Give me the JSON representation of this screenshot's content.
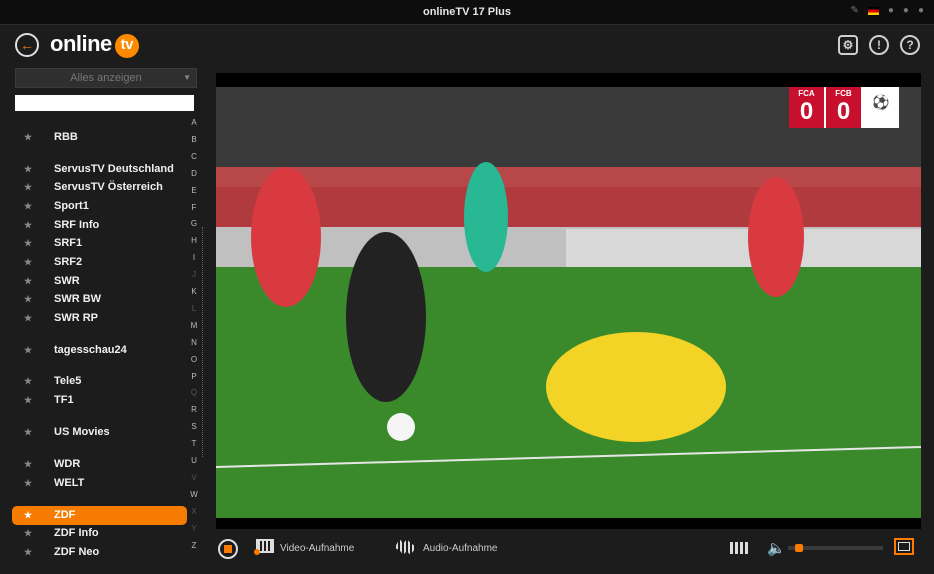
{
  "window": {
    "title": "onlineTV 17 Plus"
  },
  "header": {
    "logo_text": "online",
    "logo_badge": "tv"
  },
  "sidebar": {
    "filter_value": "Alles anzeigen",
    "search_value": "",
    "channels": [
      {
        "name": "RBB",
        "active": false
      },
      {
        "name": "ServusTV Deutschland",
        "active": false
      },
      {
        "name": "ServusTV Österreich",
        "active": false
      },
      {
        "name": "Sport1",
        "active": false
      },
      {
        "name": "SRF Info",
        "active": false
      },
      {
        "name": "SRF1",
        "active": false
      },
      {
        "name": "SRF2",
        "active": false
      },
      {
        "name": "SWR",
        "active": false
      },
      {
        "name": "SWR BW",
        "active": false
      },
      {
        "name": "SWR RP",
        "active": false
      },
      {
        "name": "tagesschau24",
        "active": false
      },
      {
        "name": "Tele5",
        "active": false
      },
      {
        "name": "TF1",
        "active": false
      },
      {
        "name": "US Movies",
        "active": false
      },
      {
        "name": "WDR",
        "active": false
      },
      {
        "name": "WELT",
        "active": false
      },
      {
        "name": "ZDF",
        "active": true
      },
      {
        "name": "ZDF Info",
        "active": false
      },
      {
        "name": "ZDF Neo",
        "active": false
      }
    ],
    "alphabet": [
      "A",
      "B",
      "C",
      "D",
      "E",
      "F",
      "G",
      "H",
      "I",
      "J",
      "K",
      "L",
      "M",
      "N",
      "O",
      "P",
      "Q",
      "R",
      "S",
      "T",
      "U",
      "V",
      "W",
      "X",
      "Y",
      "Z"
    ]
  },
  "video": {
    "score": {
      "home_team": "FCA",
      "away_team": "FCB",
      "home_score": "0",
      "away_score": "0"
    }
  },
  "controls": {
    "video_record_label": "Video-Aufnahme",
    "audio_record_label": "Audio-Aufnahme",
    "volume_fraction": 0.08
  },
  "colors": {
    "accent": "#f57c00",
    "background": "#1c1c1c"
  }
}
